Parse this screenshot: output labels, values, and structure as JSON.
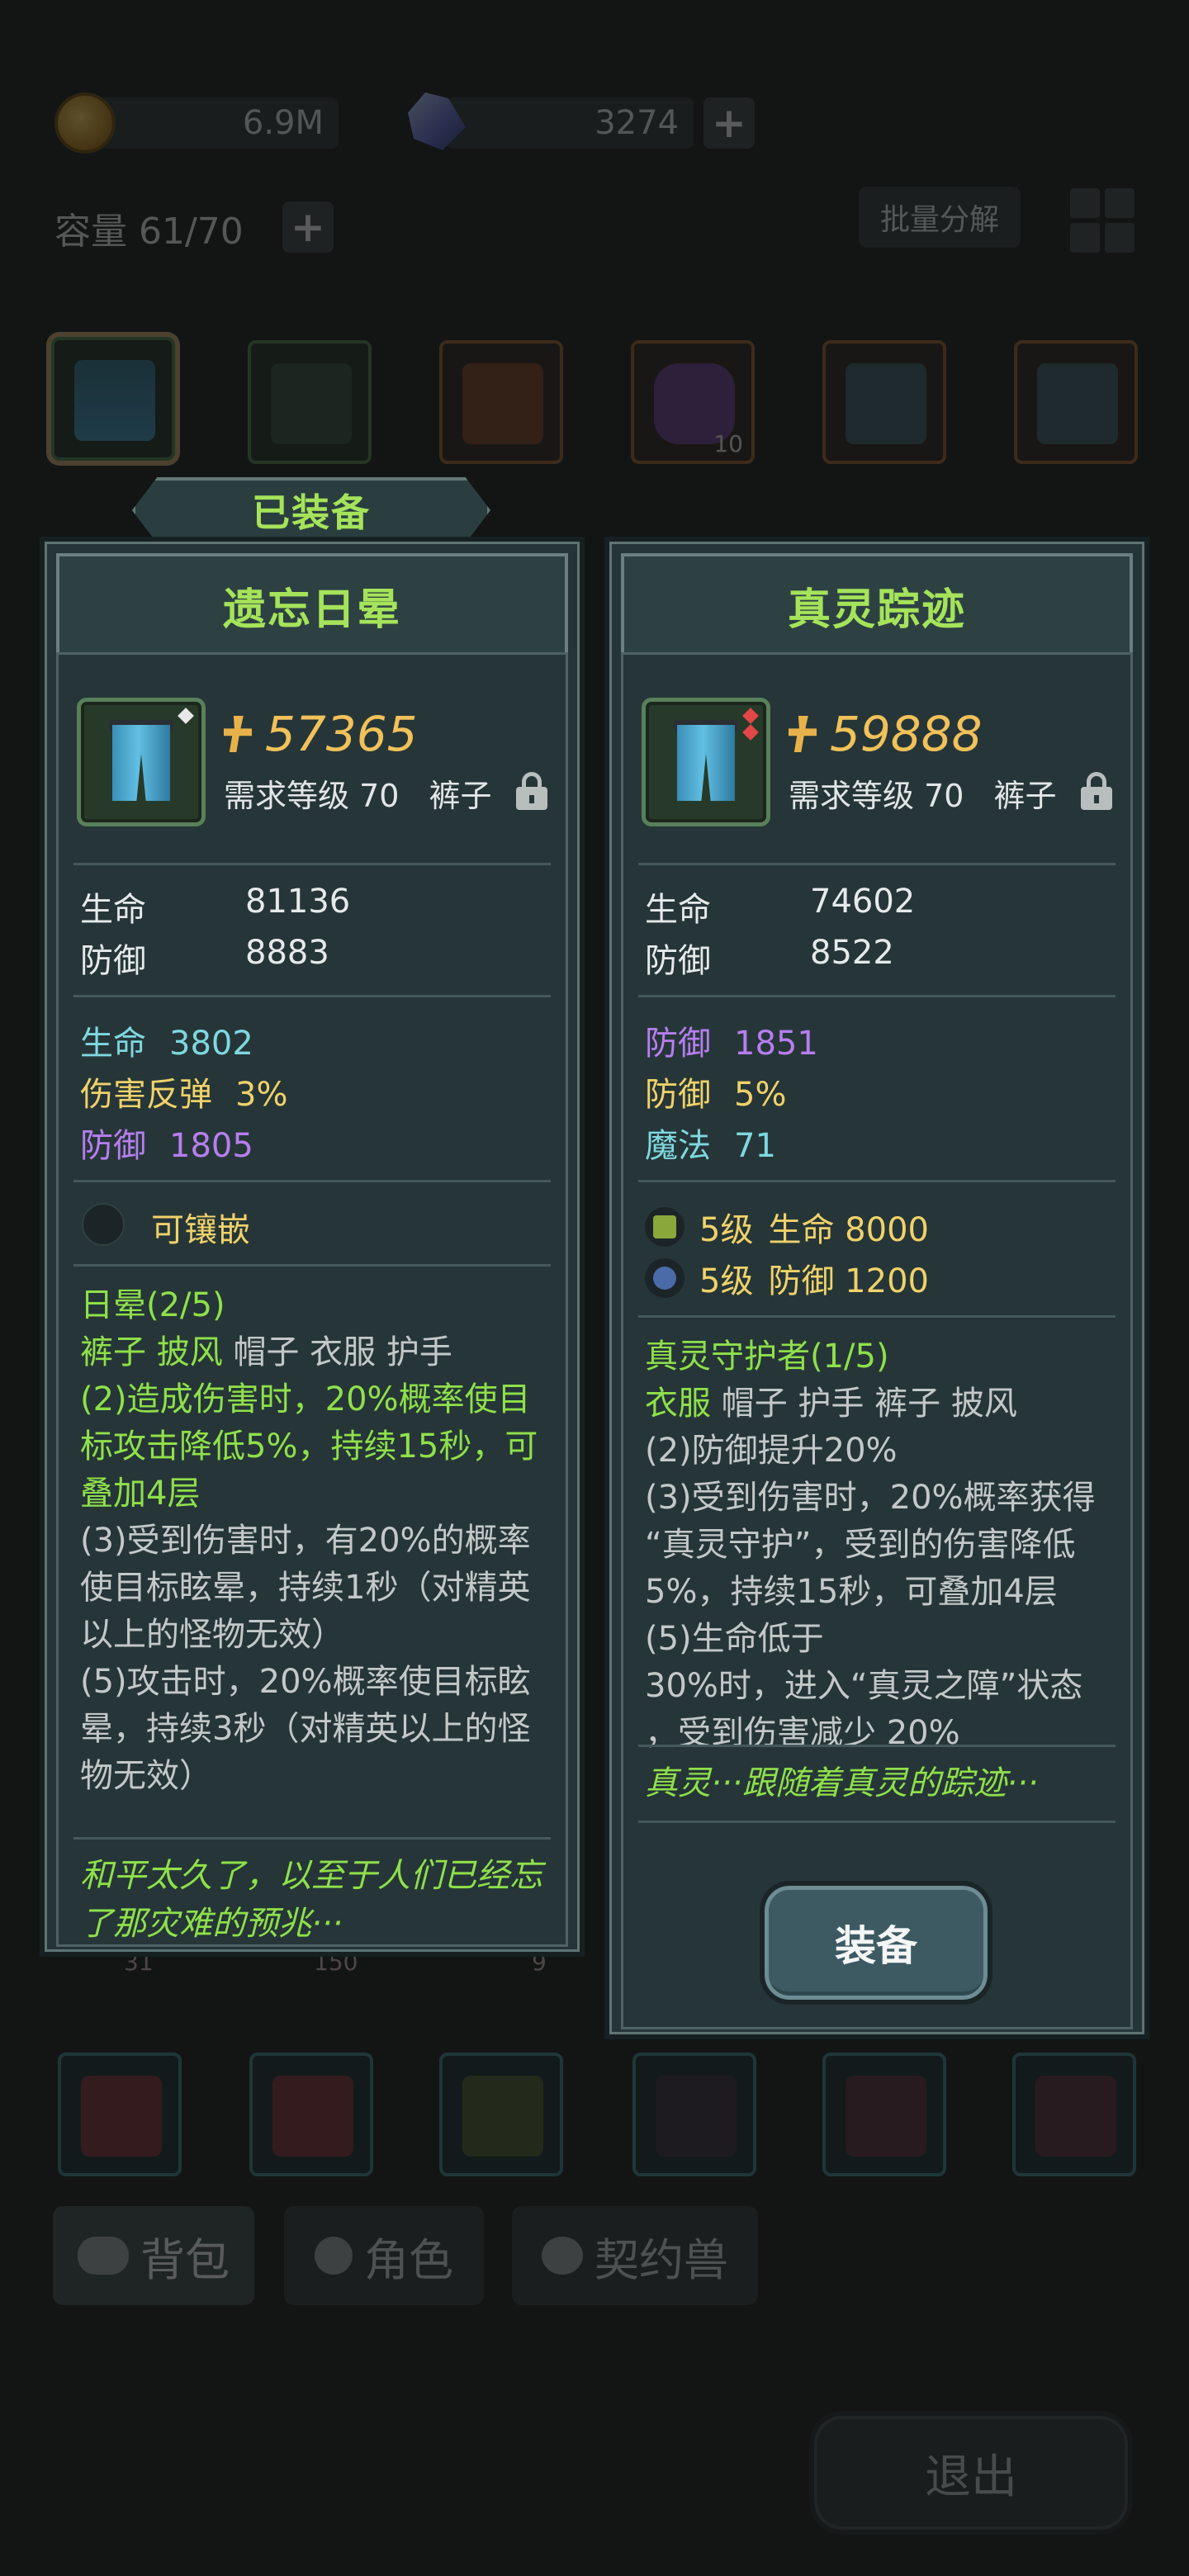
{
  "resources": {
    "gold": "6.9M",
    "crystals": "3274",
    "add_label": "+"
  },
  "inventory": {
    "capacity": "容量 61/70",
    "batch_decompose": "批量分解",
    "slot_counts": [
      "10",
      "31",
      "150",
      "9"
    ]
  },
  "nav": {
    "tabs": [
      {
        "label": "背包"
      },
      {
        "label": "角色"
      },
      {
        "label": "契约兽"
      }
    ],
    "exit": "退出"
  },
  "equipped_label": "已装备",
  "equipped": {
    "name": "遗忘日晕",
    "power": "57365",
    "req_level": "需求等级 70",
    "type": "裤子",
    "base_stats": [
      {
        "name": "生命",
        "value": "81136"
      },
      {
        "name": "防御",
        "value": "8883"
      }
    ],
    "extra_attrs": [
      {
        "name": "生命",
        "value": "3802",
        "color": "#7fd8e0"
      },
      {
        "name": "伤害反弹",
        "value": "3%",
        "color": "#f0d26a"
      },
      {
        "name": "防御",
        "value": "1805",
        "color": "#b77ef0"
      }
    ],
    "socket": "可镶嵌",
    "set": {
      "title": "日晕(2/5)",
      "pieces_owned": "裤子 披风",
      "pieces_missing": "帽子 衣服 护手",
      "effect_active": [
        "(2)造成伤害时，20%概率使目",
        "标攻击降低5%，持续15秒，可",
        "叠加4层"
      ],
      "effect_inactive": [
        "(3)受到伤害时，有20%的概率",
        "使目标眩晕，持续1秒（对精英",
        "以上的怪物无效）",
        "(5)攻击时，20%概率使目标眩",
        "晕，持续3秒（对精英以上的怪",
        "物无效）"
      ]
    },
    "flavor": [
      "和平太久了，以至于人们已经忘",
      "了那灾难的预兆···"
    ]
  },
  "candidate": {
    "name": "真灵踪迹",
    "power": "59888",
    "req_level": "需求等级 70",
    "type": "裤子",
    "base_stats": [
      {
        "name": "生命",
        "value": "74602"
      },
      {
        "name": "防御",
        "value": "8522"
      }
    ],
    "extra_attrs": [
      {
        "name": "防御",
        "value": "1851",
        "color": "#b77ef0"
      },
      {
        "name": "防御",
        "value": "5%",
        "color": "#f0d26a"
      },
      {
        "name": "魔法",
        "value": "71",
        "color": "#7fd8e0"
      }
    ],
    "gems": [
      {
        "level": "5级",
        "effect": "生命 8000",
        "icon": "green-gem-icon"
      },
      {
        "level": "5级",
        "effect": "防御 1200",
        "icon": "blue-gem-icon"
      }
    ],
    "set": {
      "title": "真灵守护者(1/5)",
      "pieces_owned": "衣服",
      "pieces_missing": "帽子 护手 裤子 披风",
      "effect_inactive": [
        "(2)防御提升20%",
        "(3)受到伤害时，20%概率获得",
        "“真灵守护”，受到的伤害降低",
        "5%，持续15秒，可叠加4层",
        "(5)生命低于",
        "30%时，进入“真灵之障”状态",
        "，受到伤害减少 20%"
      ]
    },
    "flavor": [
      "真灵···跟随着真灵的踪迹···"
    ],
    "equip_button": "装备"
  }
}
